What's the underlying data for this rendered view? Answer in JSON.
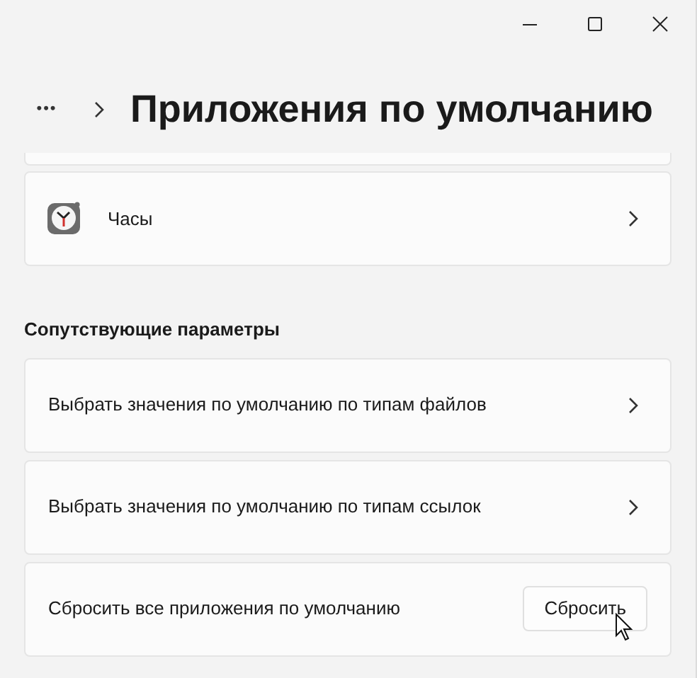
{
  "window": {
    "controls": [
      {
        "kind": "minimize"
      },
      {
        "kind": "maximize"
      },
      {
        "kind": "close"
      }
    ]
  },
  "header": {
    "more": "•••",
    "title": "Приложения по умолчанию"
  },
  "apps": [
    {
      "name": "Часы"
    }
  ],
  "related": {
    "heading": "Сопутствующие параметры",
    "items": [
      {
        "kind": "link",
        "label": "Выбрать значения по умолчанию по типам файлов"
      },
      {
        "kind": "link",
        "label": "Выбрать значения по умолчанию по типам ссылок"
      },
      {
        "kind": "button",
        "label": "Сбросить все приложения по умолчанию",
        "button": "Сбросить"
      }
    ]
  }
}
